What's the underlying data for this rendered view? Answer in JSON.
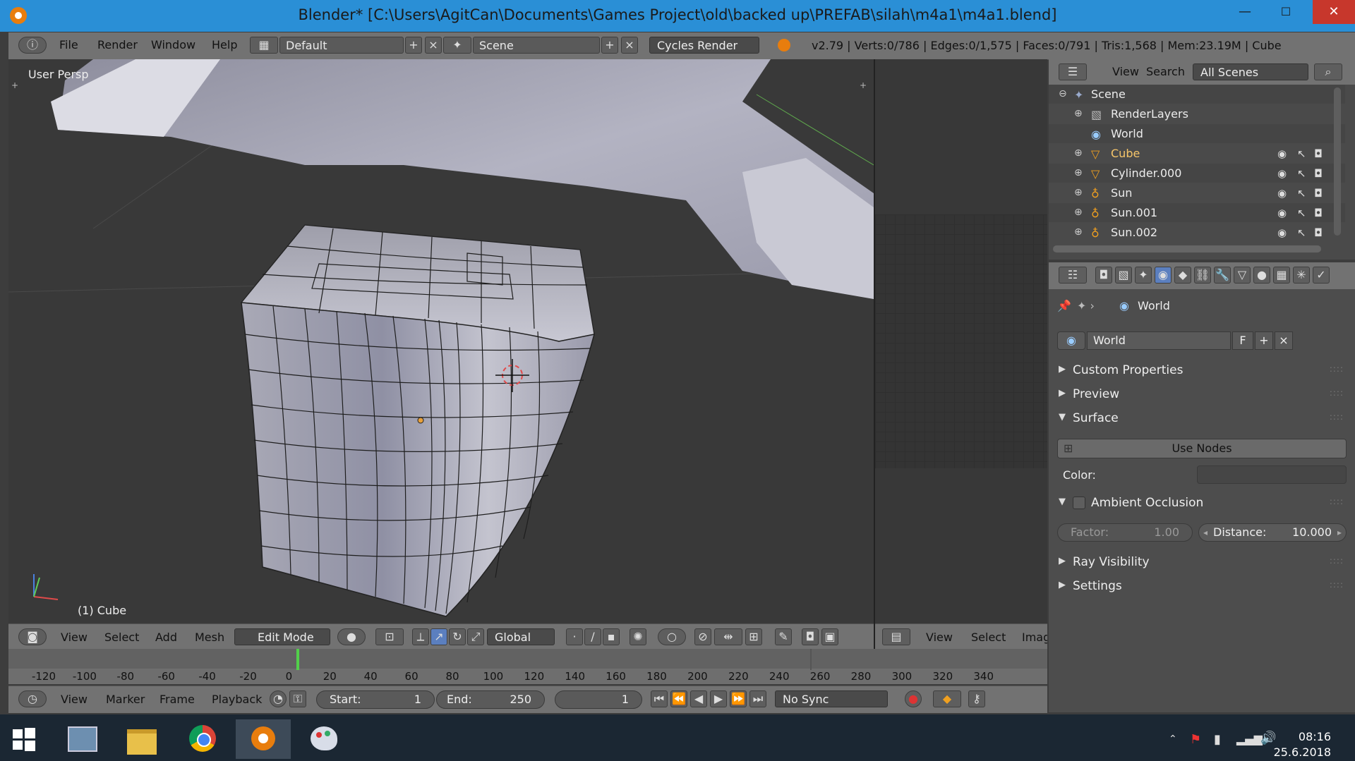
{
  "window": {
    "title": "Blender* [C:\\Users\\AgitCan\\Documents\\Games Project\\old\\backed up\\PREFAB\\silah\\m4a1\\m4a1.blend]",
    "minimize": "—",
    "maximize": "☐",
    "close": "✕"
  },
  "menubar": {
    "items": [
      "File",
      "Render",
      "Window",
      "Help"
    ],
    "layout": "Default",
    "scene": "Scene",
    "engine": "Cycles Render",
    "stats": "v2.79 | Verts:0/786 | Edges:0/1,575 | Faces:0/791 | Tris:1,568 | Mem:23.19M | Cube"
  },
  "viewport": {
    "label": "User Persp",
    "object": "(1) Cube"
  },
  "view3d_header": {
    "items": [
      "View",
      "Select",
      "Add",
      "Mesh"
    ],
    "mode": "Edit Mode",
    "orientation": "Global"
  },
  "image_header": {
    "items": [
      "View",
      "Select",
      "Imag"
    ]
  },
  "timeline": {
    "ticks": [
      "-120",
      "-100",
      "-80",
      "-60",
      "-40",
      "-20",
      "0",
      "20",
      "40",
      "60",
      "80",
      "100",
      "120",
      "140",
      "160",
      "180",
      "200",
      "220",
      "240",
      "260",
      "280",
      "300",
      "320",
      "340"
    ],
    "current_frame": 1
  },
  "playback": {
    "items": [
      "View",
      "Marker",
      "Frame",
      "Playback"
    ],
    "start_label": "Start:",
    "start_value": "1",
    "end_label": "End:",
    "end_value": "250",
    "frame_value": "1",
    "sync": "No Sync"
  },
  "outliner": {
    "header_items": [
      "View",
      "Search"
    ],
    "filter": "All Scenes",
    "rows": [
      {
        "name": "Scene"
      },
      {
        "name": "RenderLayers"
      },
      {
        "name": "World"
      },
      {
        "name": "Cube"
      },
      {
        "name": "Cylinder.000"
      },
      {
        "name": "Sun"
      },
      {
        "name": "Sun.001"
      },
      {
        "name": "Sun.002"
      }
    ]
  },
  "properties": {
    "breadcrumb": "World",
    "datablock": "World",
    "fake_user": "F",
    "panels": {
      "custom_properties": "Custom Properties",
      "preview": "Preview",
      "surface": "Surface",
      "use_nodes": "Use Nodes",
      "color_label": "Color:",
      "ambient_occlusion": "Ambient Occlusion",
      "factor_label": "Factor:",
      "factor_value": "1.00",
      "distance_label": "Distance:",
      "distance_value": "10.000",
      "ray_visibility": "Ray Visibility",
      "settings": "Settings"
    }
  },
  "taskbar": {
    "time": "08:16",
    "date": "25.6.2018"
  },
  "colors": {
    "titlebar": "#2a8fd6",
    "close": "#c7372c",
    "blender_orange": "#e87d0d",
    "frame_marker": "#52d04a"
  }
}
